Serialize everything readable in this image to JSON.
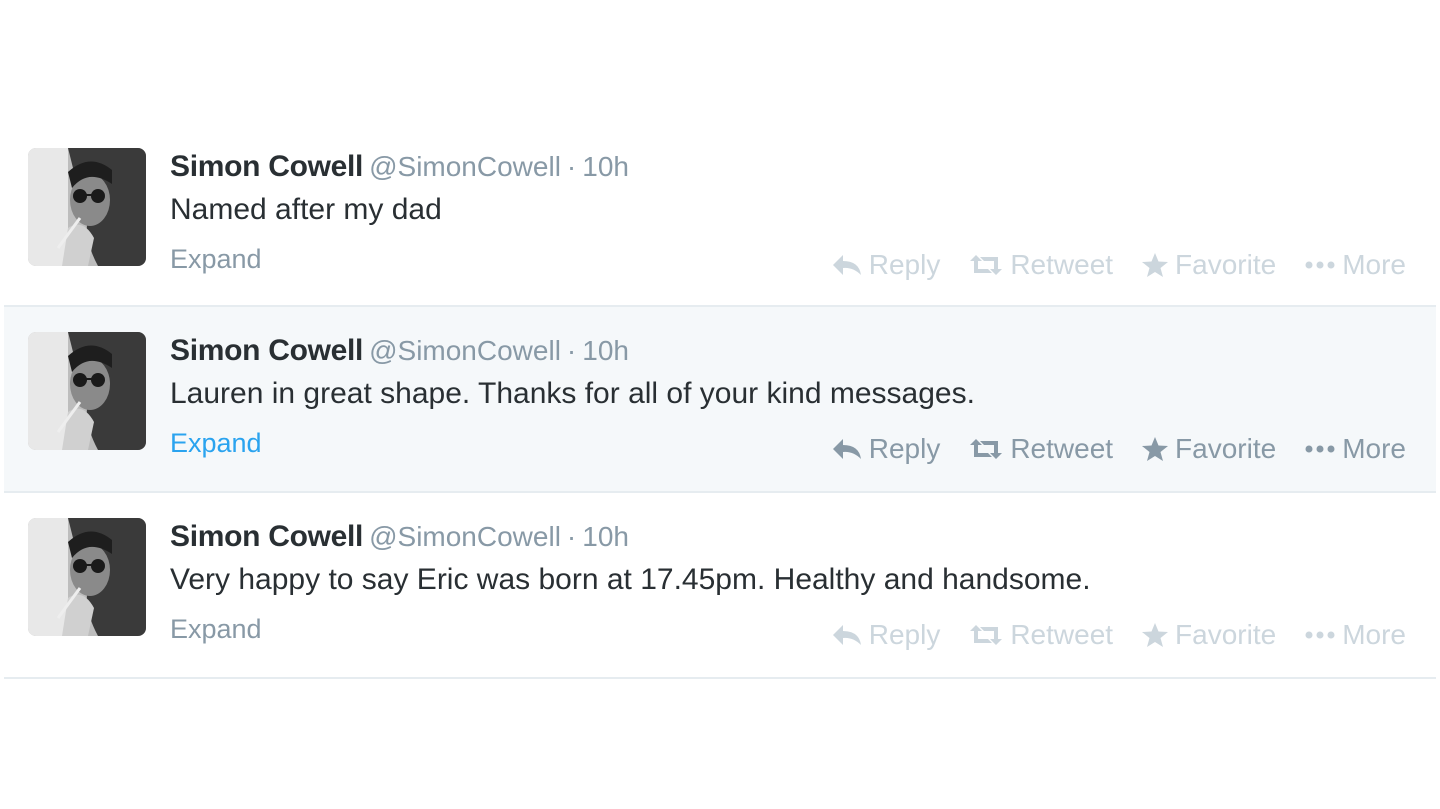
{
  "tweets": [
    {
      "name": "Simon Cowell",
      "handle": "@SimonCowell",
      "separator": "·",
      "time": "10h",
      "text": "Named after my dad",
      "expand": "Expand",
      "hover": false
    },
    {
      "name": "Simon Cowell",
      "handle": "@SimonCowell",
      "separator": "·",
      "time": "10h",
      "text": "Lauren in great shape. Thanks for all of your kind messages.",
      "expand": "Expand",
      "hover": true
    },
    {
      "name": "Simon Cowell",
      "handle": "@SimonCowell",
      "separator": "·",
      "time": "10h",
      "text": "Very happy to say Eric was born at 17.45pm. Healthy and handsome.",
      "expand": "Expand",
      "hover": false
    }
  ],
  "actions": {
    "reply": "Reply",
    "retweet": "Retweet",
    "favorite": "Favorite",
    "more": "More"
  },
  "icons": {
    "reply": "reply-arrow-icon",
    "retweet": "retweet-arrows-icon",
    "favorite": "star-icon",
    "more": "ellipsis-icon"
  },
  "colors": {
    "name": "#292f33",
    "muted": "#8899a6",
    "faded": "#ccd6dd",
    "link": "#2aa3ef",
    "hover_bg": "#f5f8fa",
    "divider": "#e6ecf0"
  }
}
